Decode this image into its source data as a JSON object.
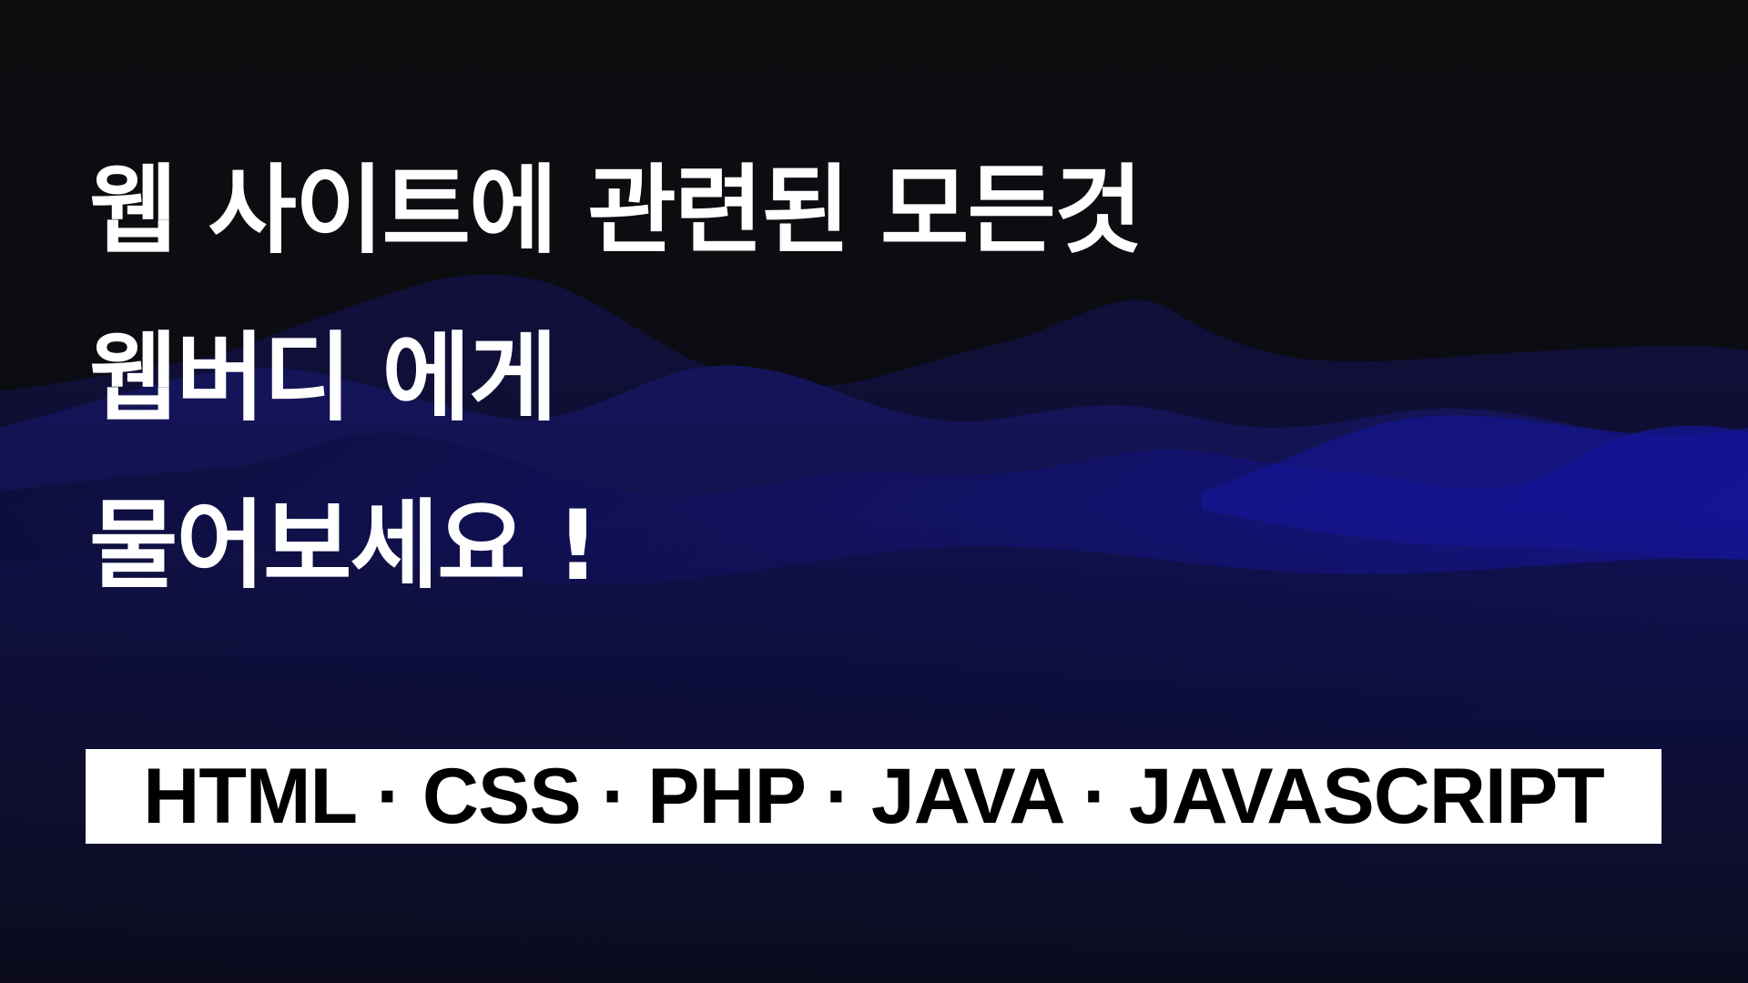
{
  "headline": {
    "line1": "웹 사이트에 관련된 모든것",
    "line2": "웹버디 에게",
    "line3": "물어보세요 !"
  },
  "banner": {
    "text": "HTML · CSS · PHP · JAVA · JAVASCRIPT"
  },
  "colors": {
    "background": "#0b0b0f",
    "mountain_accent": "#13138f",
    "text": "#ffffff",
    "banner_bg": "#ffffff",
    "banner_text": "#000000"
  }
}
